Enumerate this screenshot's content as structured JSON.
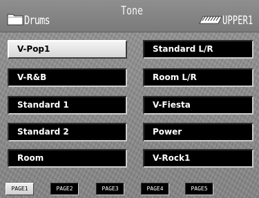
{
  "header": {
    "category": "Drums",
    "mode": "Tone",
    "part": "UPPER1",
    "icons": [
      "folder-icon",
      "keyboard-icon"
    ]
  },
  "tones": {
    "left": [
      "V-Pop1",
      "V-R&B",
      "Standard 1",
      "Standard 2",
      "Room"
    ],
    "right": [
      "Standard L/R",
      "Room L/R",
      "V-Fiesta",
      "Power",
      "V-Rock1"
    ],
    "selected": "V-Pop1"
  },
  "pages": [
    "PAGE1",
    "PAGE2",
    "PAGE3",
    "PAGE4",
    "PAGE5"
  ],
  "active_page": "PAGE1",
  "colors": {
    "background": "#8e8e8e",
    "button": "#000000",
    "selected_button": "#e6e6e6",
    "text": "#ffffff"
  }
}
